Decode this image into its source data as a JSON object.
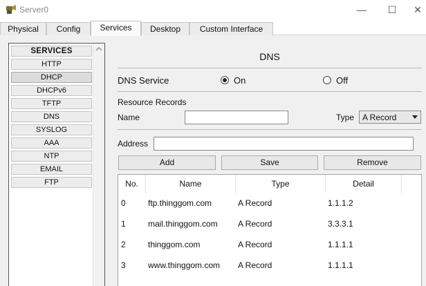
{
  "window": {
    "title": "Server0",
    "minimize": "—",
    "maximize": "☐",
    "close": "✕"
  },
  "tabs": [
    {
      "label": "Physical"
    },
    {
      "label": "Config"
    },
    {
      "label": "Services"
    },
    {
      "label": "Desktop"
    },
    {
      "label": "Custom Interface"
    }
  ],
  "active_tab": "Services",
  "services": {
    "header": "SERVICES",
    "items": [
      "HTTP",
      "DHCP",
      "DHCPv6",
      "TFTP",
      "DNS",
      "SYSLOG",
      "AAA",
      "NTP",
      "EMAIL",
      "FTP"
    ],
    "selected": "DHCP"
  },
  "dns": {
    "title": "DNS",
    "service_label": "DNS Service",
    "on_label": "On",
    "off_label": "Off",
    "service_state": "On",
    "resource_records_label": "Resource Records",
    "name_label": "Name",
    "name_value": "",
    "type_label": "Type",
    "type_value": "A Record",
    "address_label": "Address",
    "address_value": "",
    "buttons": {
      "add": "Add",
      "save": "Save",
      "remove": "Remove"
    },
    "table": {
      "headers": [
        "No.",
        "Name",
        "Type",
        "Detail"
      ],
      "rows": [
        {
          "no": "0",
          "name": "ftp.thinggom.com",
          "type": "A Record",
          "detail": "1.1.1.2"
        },
        {
          "no": "1",
          "name": "mail.thinggom.com",
          "type": "A Record",
          "detail": "3.3.3.1"
        },
        {
          "no": "2",
          "name": "thinggom.com",
          "type": "A Record",
          "detail": "1.1.1.1"
        },
        {
          "no": "3",
          "name": "www.thinggom.com",
          "type": "A Record",
          "detail": "1.1.1.1"
        }
      ]
    }
  }
}
